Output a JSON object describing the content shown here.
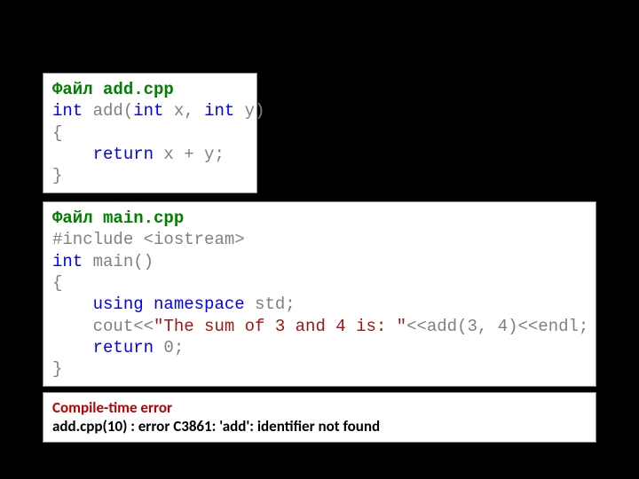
{
  "box1": {
    "file_label": "Файл ",
    "file_name": "add.cpp",
    "l1_a": "int",
    "l1_b": " add(",
    "l1_c": "int",
    "l1_d": " x, ",
    "l1_e": "int",
    "l1_f": " y)",
    "l2": "{",
    "l3_a": "    ",
    "l3_b": "return",
    "l3_c": " x + y;",
    "l4": "}"
  },
  "box2": {
    "file_label": "Файл ",
    "file_name": "main.cpp",
    "l1_a": "#include ",
    "l1_b": "<iostream>",
    "l2_a": "int",
    "l2_b": " main()",
    "l3": "{",
    "l4_a": "    ",
    "l4_b": "using",
    "l4_c": " ",
    "l4_d": "namespace",
    "l4_e": " std;",
    "l5_a": "    ",
    "l5_b": "cout<<",
    "l5_c": "\"The sum of 3 and 4 is: \"",
    "l5_d": "<<add(3, 4)<<endl;",
    "l6_a": "    ",
    "l6_b": "return",
    "l6_c": " 0;",
    "l7": "}"
  },
  "error": {
    "title": "Compile-time error",
    "body": "add.cpp(10) : error C3861: 'add': identifier not found"
  }
}
